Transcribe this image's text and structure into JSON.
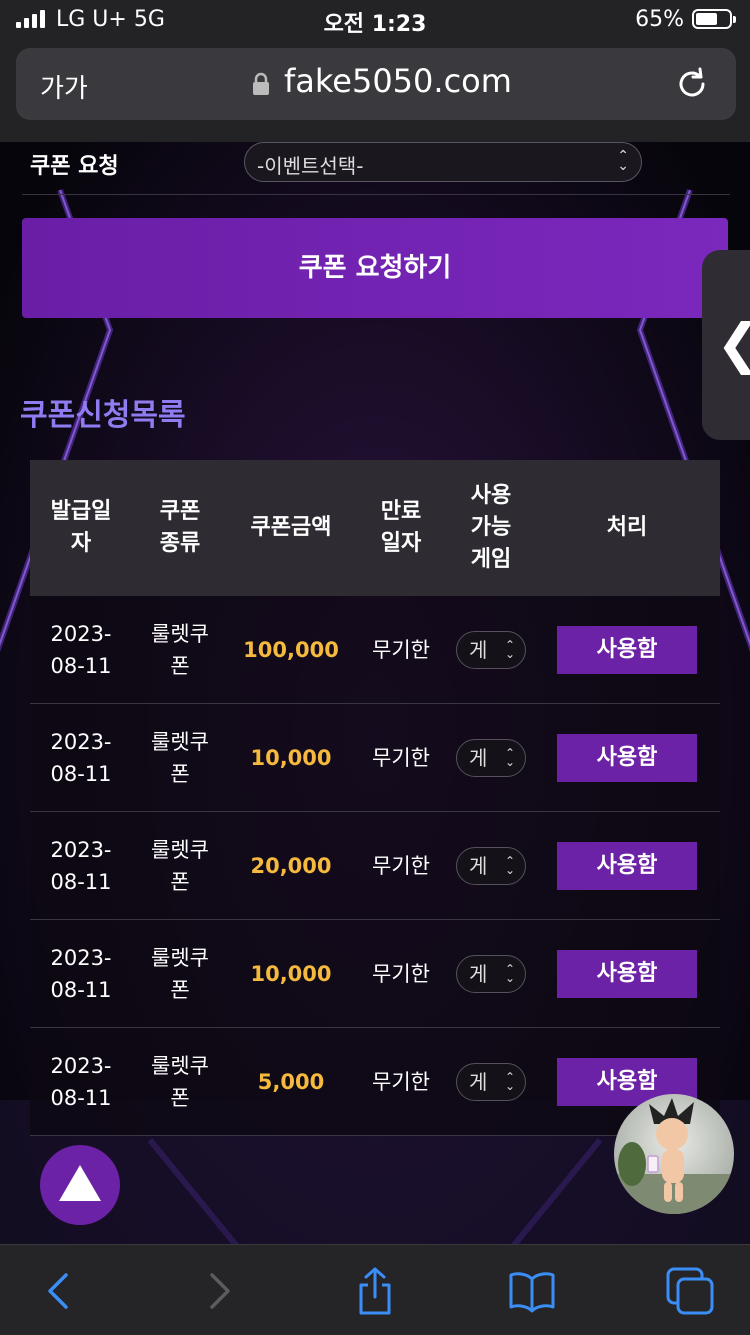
{
  "status": {
    "carrier": "LG U+  5G",
    "time": "오전 1:23",
    "battery": "65%",
    "battery_level": 0.65
  },
  "browser": {
    "text_size_label": "가가",
    "url": "fake5050.com"
  },
  "request": {
    "label": "쿠폰 요청",
    "event_select_value": "-이벤트선택-",
    "submit_label": "쿠폰 요청하기"
  },
  "list": {
    "title": "쿠폰신청목록",
    "headers": {
      "date": "발급일자",
      "type": "쿠폰종류",
      "amount": "쿠폰금액",
      "expiry": "만료일자",
      "games": "사용가능게임",
      "action": "처리"
    },
    "rows": [
      {
        "date": "2023-08-11",
        "type": "룰렛쿠폰",
        "amount": "100,000",
        "expiry": "무기한",
        "game": "게",
        "action": "사용함"
      },
      {
        "date": "2023-08-11",
        "type": "룰렛쿠폰",
        "amount": "10,000",
        "expiry": "무기한",
        "game": "게",
        "action": "사용함"
      },
      {
        "date": "2023-08-11",
        "type": "룰렛쿠폰",
        "amount": "20,000",
        "expiry": "무기한",
        "game": "게",
        "action": "사용함"
      },
      {
        "date": "2023-08-11",
        "type": "룰렛쿠폰",
        "amount": "10,000",
        "expiry": "무기한",
        "game": "게",
        "action": "사용함"
      },
      {
        "date": "2023-08-11",
        "type": "룰렛쿠폰",
        "amount": "5,000",
        "expiry": "무기한",
        "game": "게",
        "action": "사용함"
      }
    ]
  },
  "side_tab_glyph": "❮",
  "colors": {
    "accent": "#6c22a6",
    "amount": "#f4b93d",
    "title": "#8f7cf0",
    "ios_blue": "#3a8ef6"
  }
}
